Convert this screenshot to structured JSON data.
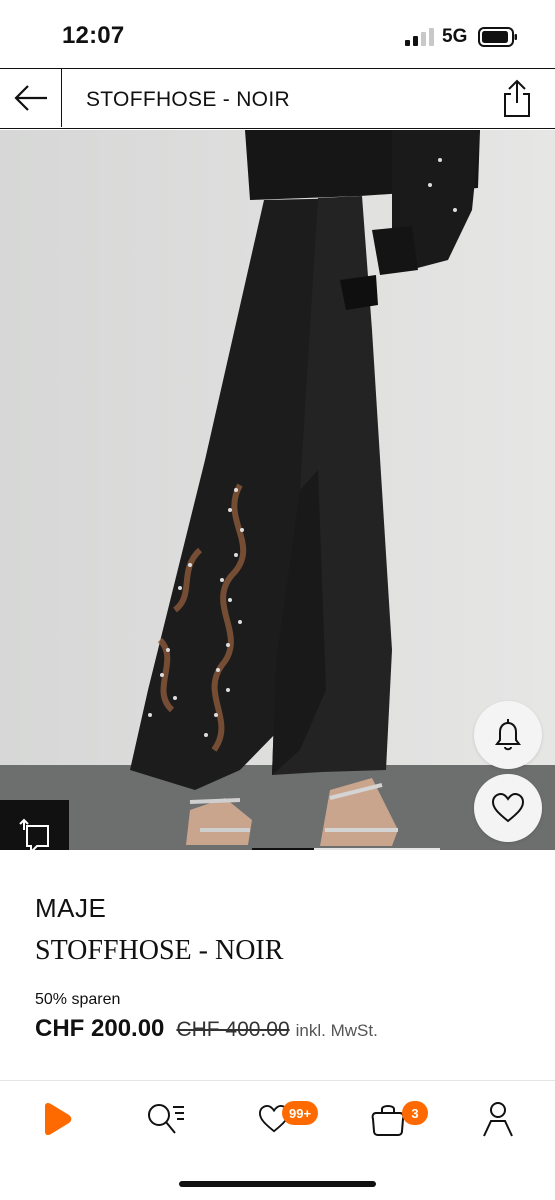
{
  "status": {
    "time": "12:07",
    "network": "5G"
  },
  "header": {
    "title": "STOFFHOSE - NOIR",
    "back_icon": "arrow-left-icon",
    "share_icon": "share-icon"
  },
  "gallery": {
    "image": "black embroidered wide-leg trousers with silver strappy sandals",
    "current_slide": 1,
    "total_slides": 3
  },
  "product": {
    "brand": "MAJE",
    "name": "STOFFHOSE - NOIR",
    "discount_label": "50% sparen",
    "price": "CHF 200.00",
    "original_price": "CHF 400.00",
    "vat_note": "inkl. MwSt."
  },
  "nav": {
    "wishlist_badge": "99+",
    "cart_badge": "3"
  },
  "colors": {
    "accent": "#ff6a00",
    "text": "#111111",
    "background": "#ffffff"
  }
}
